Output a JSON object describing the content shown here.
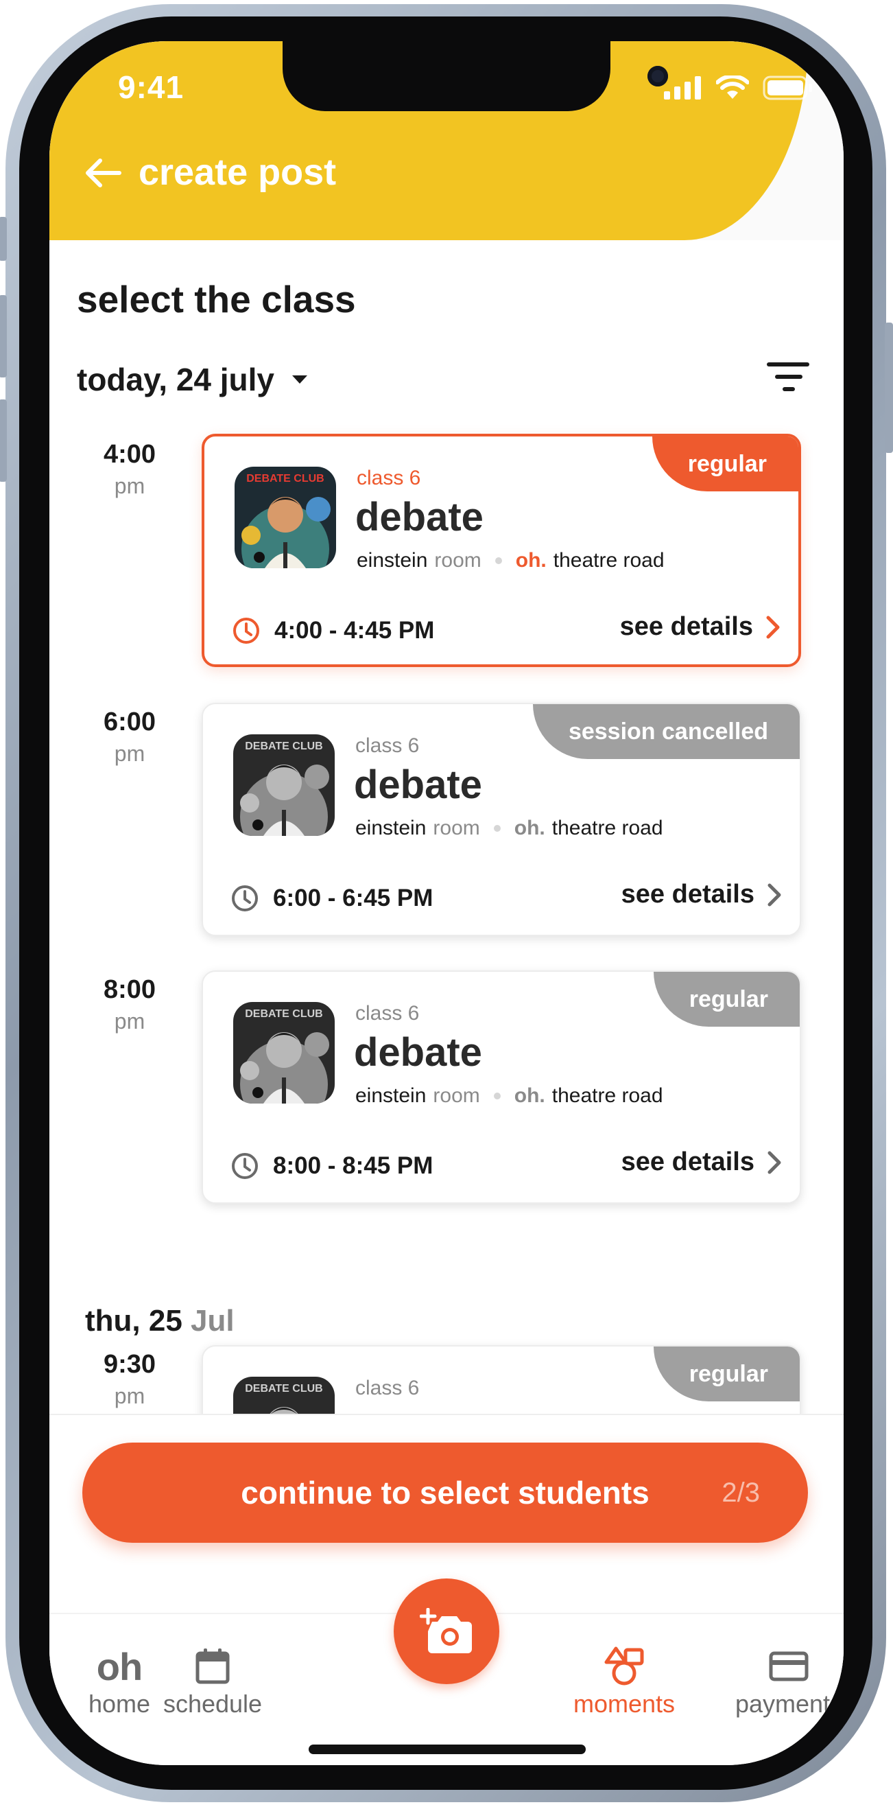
{
  "status_bar": {
    "time": "9:41"
  },
  "header": {
    "title": "create post"
  },
  "section_title": "select the class",
  "date_filter": {
    "selected": "today, 24 july"
  },
  "classes": [
    {
      "time": "4:00",
      "ampm": "pm",
      "badge": "regular",
      "class_label": "class 6",
      "name": "debate",
      "room": "einstein",
      "room_suffix": "room",
      "brand": "oh.",
      "venue": "theatre road",
      "time_range": "4:00 - 4:45 PM",
      "details_label": "see details",
      "selected": true
    },
    {
      "time": "6:00",
      "ampm": "pm",
      "badge": "session cancelled",
      "class_label": "class 6",
      "name": "debate",
      "room": "einstein",
      "room_suffix": "room",
      "brand": "oh.",
      "venue": "theatre road",
      "time_range": "6:00 - 6:45 PM",
      "details_label": "see details",
      "selected": false
    },
    {
      "time": "8:00",
      "ampm": "pm",
      "badge": "regular",
      "class_label": "class 6",
      "name": "debate",
      "room": "einstein",
      "room_suffix": "room",
      "brand": "oh.",
      "venue": "theatre road",
      "time_range": "8:00 - 8:45 PM",
      "details_label": "see details",
      "selected": false
    }
  ],
  "next_day": {
    "label_main": "thu, 25",
    "label_muted": "Jul",
    "class": {
      "time": "9:30",
      "ampm": "pm",
      "badge": "regular",
      "class_label": "class 6"
    }
  },
  "thumbnail_text": "DEBATE CLUB",
  "cta": {
    "label": "continue to select students",
    "step": "2/3"
  },
  "tabs": [
    {
      "label": "home",
      "icon": "oh"
    },
    {
      "label": "schedule",
      "icon": "calendar-icon"
    },
    {
      "label": "moments",
      "icon": "moments-icon",
      "active": true
    },
    {
      "label": "payments",
      "icon": "card-icon"
    }
  ],
  "colors": {
    "accent": "#ee5a2e",
    "header": "#f2c422",
    "muted": "#a0a0a0"
  }
}
